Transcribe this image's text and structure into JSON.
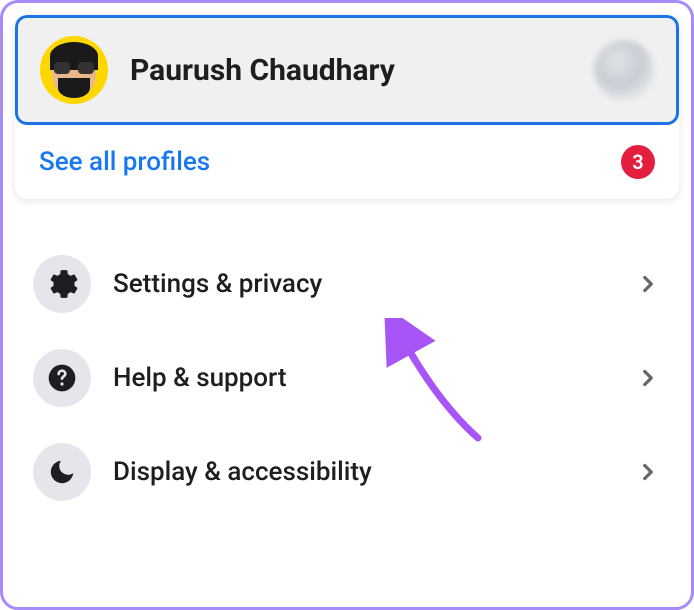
{
  "profile": {
    "name": "Paurush Chaudhary",
    "see_all_label": "See all profiles",
    "badge_count": "3"
  },
  "menu": {
    "items": [
      {
        "label": "Settings & privacy",
        "icon": "gear"
      },
      {
        "label": "Help & support",
        "icon": "question"
      },
      {
        "label": "Display & accessibility",
        "icon": "moon"
      }
    ]
  }
}
